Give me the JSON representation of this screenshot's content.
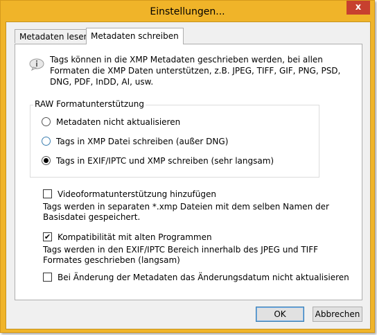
{
  "window": {
    "title": "Einstellungen...",
    "close_glyph": "x"
  },
  "tabs": [
    {
      "label": "Metadaten lesen",
      "active": false
    },
    {
      "label": "Metadaten schreiben",
      "active": true
    }
  ],
  "info": {
    "icon": "info-speech-bubble-icon",
    "text": "Tags können in die XMP Metadaten geschrieben werden, bei allen Formaten die XMP Daten unterstützen, z.B. JPEG, TIFF, GIF, PNG, PSD, DNG, PDF, InDD, AI, usw."
  },
  "raw_group": {
    "title": "RAW Formatunterstützung",
    "options": [
      {
        "label": "Metadaten nicht aktualisieren",
        "selected": false
      },
      {
        "label": "Tags in XMP Datei schreiben (außer DNG)",
        "selected": false
      },
      {
        "label": "Tags in EXIF/IPTC und XMP schreiben (sehr langsam)",
        "selected": true
      }
    ]
  },
  "options": {
    "video": {
      "label": "Videoformatunterstützung hinzufügen",
      "checked": false,
      "description": "Tags werden in separaten *.xmp Dateien mit dem selben Namen der Basisdatei gespeichert."
    },
    "compat": {
      "label": "Kompatibilität mit alten Programmen",
      "checked": true,
      "description": "Tags werden in den EXIF/IPTC Bereich innerhalb des JPEG und TIFF Formates geschrieben (langsam)"
    },
    "date": {
      "label": "Bei Änderung der Metadaten das Änderungsdatum nicht aktualisieren",
      "checked": false
    }
  },
  "buttons": {
    "ok": "OK",
    "cancel": "Abbrechen"
  },
  "colors": {
    "frame": "#f0b429",
    "close": "#c7402f",
    "default_button_border": "#3c7fb1"
  }
}
